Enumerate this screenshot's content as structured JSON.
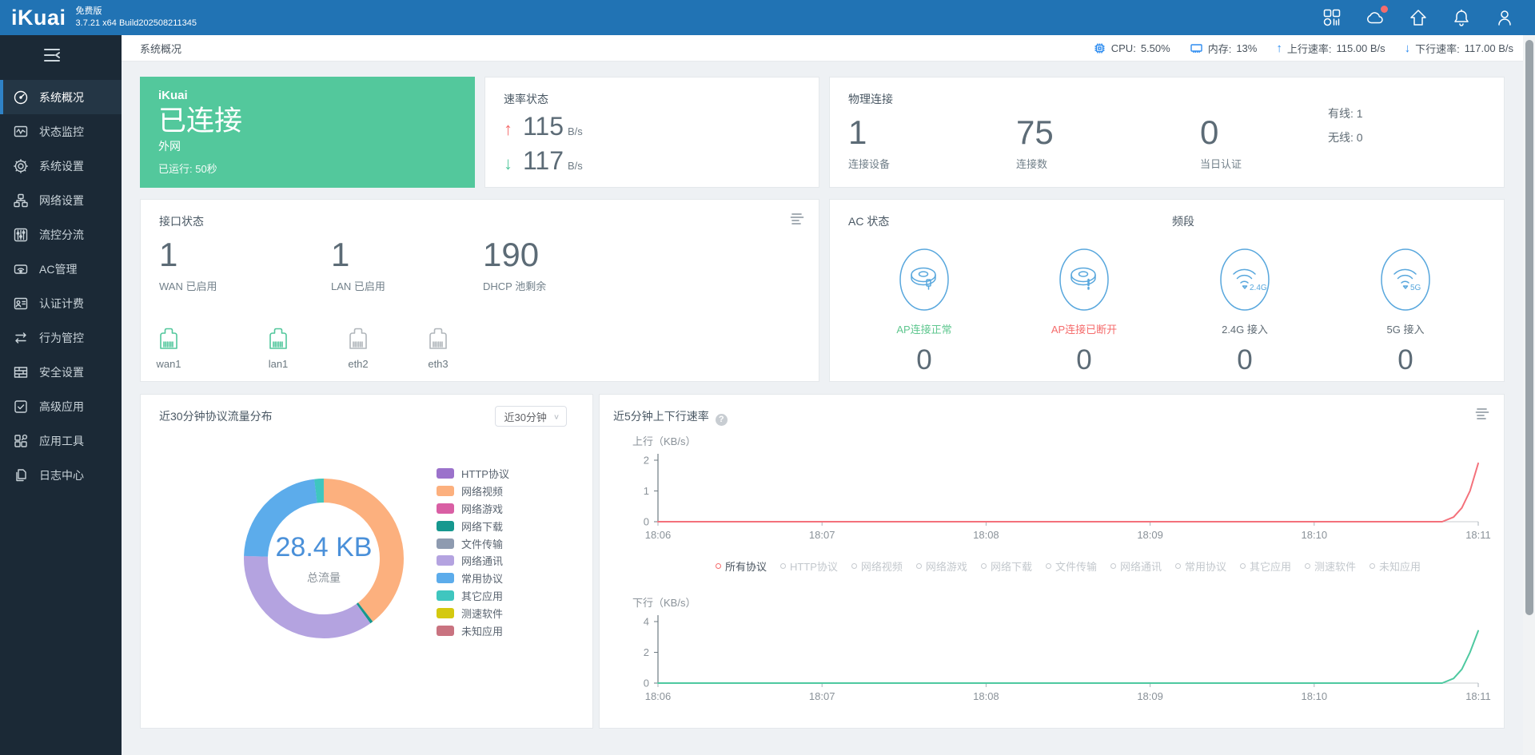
{
  "topbar": {
    "logo": "iKuai",
    "edition": "免费版",
    "version": "3.7.21 x64 Build202508211345"
  },
  "statusbar": {
    "breadcrumb": "系统概况",
    "metrics": {
      "cpu": {
        "label": "CPU:",
        "value": "5.50%"
      },
      "memory": {
        "label": "内存:",
        "value": "13%"
      },
      "up": {
        "label": "上行速率:",
        "value": "115.00 B/s"
      },
      "down": {
        "label": "下行速率:",
        "value": "117.00 B/s"
      }
    }
  },
  "sidebar": {
    "items": [
      {
        "label": "系统概况",
        "icon": "dashboard",
        "active": true
      },
      {
        "label": "状态监控",
        "icon": "monitor",
        "active": false
      },
      {
        "label": "系统设置",
        "icon": "settings",
        "active": false
      },
      {
        "label": "网络设置",
        "icon": "network",
        "active": false
      },
      {
        "label": "流控分流",
        "icon": "flow",
        "active": false
      },
      {
        "label": "AC管理",
        "icon": "ac",
        "active": false
      },
      {
        "label": "认证计费",
        "icon": "auth",
        "active": false
      },
      {
        "label": "行为管控",
        "icon": "behavior",
        "active": false
      },
      {
        "label": "安全设置",
        "icon": "security",
        "active": false
      },
      {
        "label": "高级应用",
        "icon": "advanced",
        "active": false
      },
      {
        "label": "应用工具",
        "icon": "tools",
        "active": false
      },
      {
        "label": "日志中心",
        "icon": "logs",
        "active": false
      }
    ]
  },
  "cards": {
    "connection": {
      "brand": "iKuai",
      "status": "已连接",
      "network": "外网",
      "uptime": "已运行: 50秒"
    },
    "speed": {
      "title": "速率状态",
      "up": {
        "value": "115",
        "unit": "B/s"
      },
      "down": {
        "value": "117",
        "unit": "B/s"
      }
    },
    "physical": {
      "title": "物理连接",
      "stats": [
        {
          "value": "1",
          "label": "连接设备"
        },
        {
          "value": "75",
          "label": "连接数"
        },
        {
          "value": "0",
          "label": "当日认证"
        }
      ],
      "lines": [
        {
          "label": "有线:",
          "value": "1"
        },
        {
          "label": "无线:",
          "value": "0"
        }
      ]
    },
    "interfaces": {
      "title": "接口状态",
      "stats": [
        {
          "value": "1",
          "label": "WAN 已启用"
        },
        {
          "value": "1",
          "label": "LAN 已启用"
        },
        {
          "value": "190",
          "label": "DHCP 池剩余"
        }
      ],
      "ports": [
        {
          "name": "wan1",
          "active": true
        },
        {
          "name": "lan1",
          "active": true
        },
        {
          "name": "eth2",
          "active": false
        },
        {
          "name": "eth3",
          "active": false
        }
      ]
    },
    "ac": {
      "title": "AC 状态",
      "band_title": "频段",
      "items": [
        {
          "label": "AP连接正常",
          "value": "0",
          "type": "ap-ok"
        },
        {
          "label": "AP连接已断开",
          "value": "0",
          "type": "ap-down"
        },
        {
          "label": "2.4G 接入",
          "value": "0",
          "type": "wifi",
          "band": "2.4G"
        },
        {
          "label": "5G 接入",
          "value": "0",
          "type": "wifi",
          "band": "5G"
        }
      ]
    },
    "protocol": {
      "range_value": "近30分钟"
    },
    "rate": {
      "title": "近5分钟上下行速率",
      "legend": [
        {
          "label": "所有协议",
          "selected": true
        },
        {
          "label": "HTTP协议",
          "selected": false
        },
        {
          "label": "网络视频",
          "selected": false
        },
        {
          "label": "网络游戏",
          "selected": false
        },
        {
          "label": "网络下载",
          "selected": false
        },
        {
          "label": "文件传输",
          "selected": false
        },
        {
          "label": "网络通讯",
          "selected": false
        },
        {
          "label": "常用协议",
          "selected": false
        },
        {
          "label": "其它应用",
          "selected": false
        },
        {
          "label": "测速软件",
          "selected": false
        },
        {
          "label": "未知应用",
          "selected": false
        }
      ]
    }
  },
  "chart_data": [
    {
      "type": "pie",
      "title": "近30分钟协议流量分布",
      "total": "28.4 KB",
      "total_label": "总流量",
      "legend_position": "right",
      "slices": [
        {
          "label": "HTTP协议",
          "color": "#9b72cb",
          "percent": 0
        },
        {
          "label": "网络视频",
          "color": "#fcb07e",
          "percent": 39.5
        },
        {
          "label": "网络游戏",
          "color": "#d95fa4",
          "percent": 0
        },
        {
          "label": "网络下载",
          "color": "#16988f",
          "percent": 0.6
        },
        {
          "label": "文件传输",
          "color": "#8e9bb0",
          "percent": 0
        },
        {
          "label": "网络通讯",
          "color": "#b4a3e0",
          "percent": 35.4
        },
        {
          "label": "常用协议",
          "color": "#5caceb",
          "percent": 22.6
        },
        {
          "label": "其它应用",
          "color": "#3fc6bf",
          "percent": 1.9
        },
        {
          "label": "测速软件",
          "color": "#d4c90f",
          "percent": 0
        },
        {
          "label": "未知应用",
          "color": "#c97380",
          "percent": 0
        }
      ]
    },
    {
      "type": "line",
      "axis_title": "上行（KB/s）",
      "series_name": "所有协议",
      "color": "#f4717b",
      "x_ticks": [
        "18:06",
        "18:07",
        "18:08",
        "18:09",
        "18:10",
        "18:11"
      ],
      "y_ticks": [
        0,
        1,
        2
      ],
      "ylim": [
        0,
        2
      ],
      "xlim_minutes": [
        0,
        5
      ],
      "points": [
        [
          0,
          0
        ],
        [
          1,
          0
        ],
        [
          2,
          0
        ],
        [
          3,
          0
        ],
        [
          4,
          0
        ],
        [
          4.78,
          0
        ],
        [
          4.85,
          0.15
        ],
        [
          4.9,
          0.45
        ],
        [
          4.95,
          1.0
        ],
        [
          5,
          1.9
        ]
      ]
    },
    {
      "type": "line",
      "axis_title": "下行（KB/s）",
      "series_name": "所有协议",
      "color": "#4ec9a0",
      "x_ticks": [
        "18:06",
        "18:07",
        "18:08",
        "18:09",
        "18:10",
        "18:11"
      ],
      "y_ticks": [
        0,
        2,
        4
      ],
      "ylim": [
        0,
        4
      ],
      "xlim_minutes": [
        0,
        5
      ],
      "points": [
        [
          0,
          0
        ],
        [
          1,
          0
        ],
        [
          2,
          0
        ],
        [
          3,
          0
        ],
        [
          4,
          0
        ],
        [
          4.78,
          0
        ],
        [
          4.85,
          0.3
        ],
        [
          4.9,
          0.9
        ],
        [
          4.95,
          2.0
        ],
        [
          5,
          3.4
        ]
      ]
    }
  ]
}
